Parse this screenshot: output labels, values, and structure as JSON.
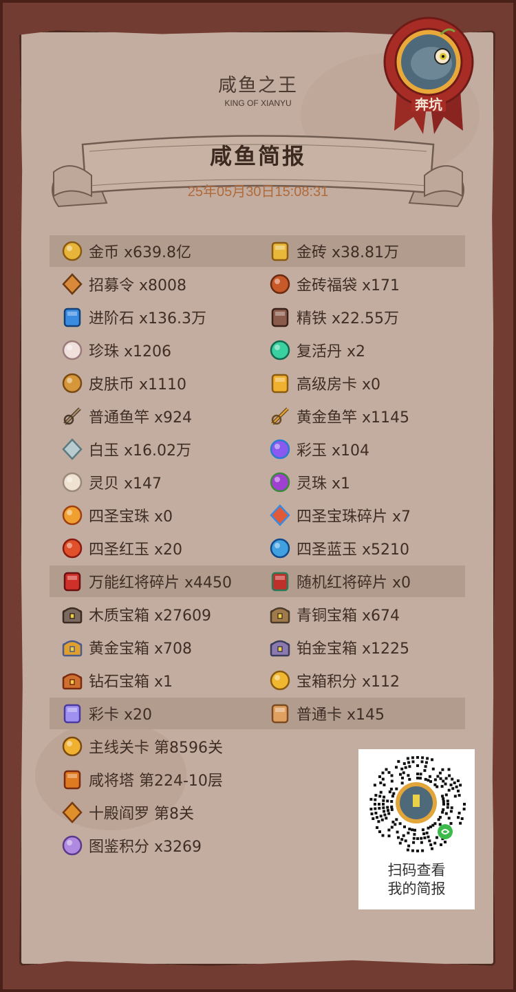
{
  "header": {
    "title": "咸鱼之王",
    "subtitle": "KING OF XIANYU"
  },
  "badge": {
    "label": "奔坑"
  },
  "report": {
    "title": "咸鱼简报",
    "datetime": "25年05月30日15:08:31"
  },
  "items_left": [
    {
      "text": "金币 x639.8亿",
      "icon": "gold-coin-icon"
    },
    {
      "text": "招募令 x8008",
      "icon": "recruit-token-icon"
    },
    {
      "text": "进阶石 x136.3万",
      "icon": "advance-stone-icon"
    },
    {
      "text": "珍珠 x1206",
      "icon": "pearl-icon"
    },
    {
      "text": "皮肤币 x1110",
      "icon": "skin-coin-icon"
    },
    {
      "text": "普通鱼竿 x924",
      "icon": "fishing-rod-icon"
    },
    {
      "text": "白玉 x16.02万",
      "icon": "white-jade-icon"
    },
    {
      "text": "灵贝 x147",
      "icon": "shell-icon"
    },
    {
      "text": "四圣宝珠 x0",
      "icon": "sacred-orb-icon"
    },
    {
      "text": "四圣红玉 x20",
      "icon": "red-jade-icon"
    },
    {
      "text": "万能红将碎片 x4450",
      "icon": "red-general-shard-icon"
    },
    {
      "text": "木质宝箱 x27609",
      "icon": "wooden-chest-icon"
    },
    {
      "text": "黄金宝箱 x708",
      "icon": "gold-chest-icon"
    },
    {
      "text": "钻石宝箱 x1",
      "icon": "diamond-chest-icon"
    },
    {
      "text": "彩卡 x20",
      "icon": "color-card-icon"
    },
    {
      "text": "主线关卡 第8596关",
      "icon": "main-stage-icon"
    },
    {
      "text": "咸将塔 第224-10层",
      "icon": "tower-icon"
    },
    {
      "text": "十殿阎罗 第8关",
      "icon": "yama-icon"
    },
    {
      "text": "图鉴积分 x3269",
      "icon": "codex-points-icon"
    }
  ],
  "items_right": [
    {
      "text": "金砖 x38.81万",
      "icon": "gold-brick-icon"
    },
    {
      "text": "金砖福袋 x171",
      "icon": "gold-bag-icon"
    },
    {
      "text": "精铁 x22.55万",
      "icon": "iron-icon"
    },
    {
      "text": "复活丹 x2",
      "icon": "revive-pill-icon"
    },
    {
      "text": "高级房卡 x0",
      "icon": "room-card-icon"
    },
    {
      "text": "黄金鱼竿 x1145",
      "icon": "gold-rod-icon"
    },
    {
      "text": "彩玉 x104",
      "icon": "color-jade-icon"
    },
    {
      "text": "灵珠 x1",
      "icon": "spirit-orb-icon"
    },
    {
      "text": "四圣宝珠碎片 x7",
      "icon": "orb-shard-icon"
    },
    {
      "text": "四圣蓝玉 x5210",
      "icon": "blue-jade-icon"
    },
    {
      "text": "随机红将碎片 x0",
      "icon": "random-shard-icon"
    },
    {
      "text": "青铜宝箱 x674",
      "icon": "bronze-chest-icon"
    },
    {
      "text": "铂金宝箱 x1225",
      "icon": "platinum-chest-icon"
    },
    {
      "text": "宝箱积分 x112",
      "icon": "chest-points-icon"
    },
    {
      "text": "普通卡 x145",
      "icon": "normal-card-icon"
    }
  ],
  "qr": {
    "caption_line1": "扫码查看",
    "caption_line2": "我的简报"
  },
  "colors": {
    "frame": "#733c32",
    "paper": "#c3ada0",
    "highlight_row": "#b29c8e",
    "date": "#b06a3a",
    "text": "#3f2e26"
  }
}
